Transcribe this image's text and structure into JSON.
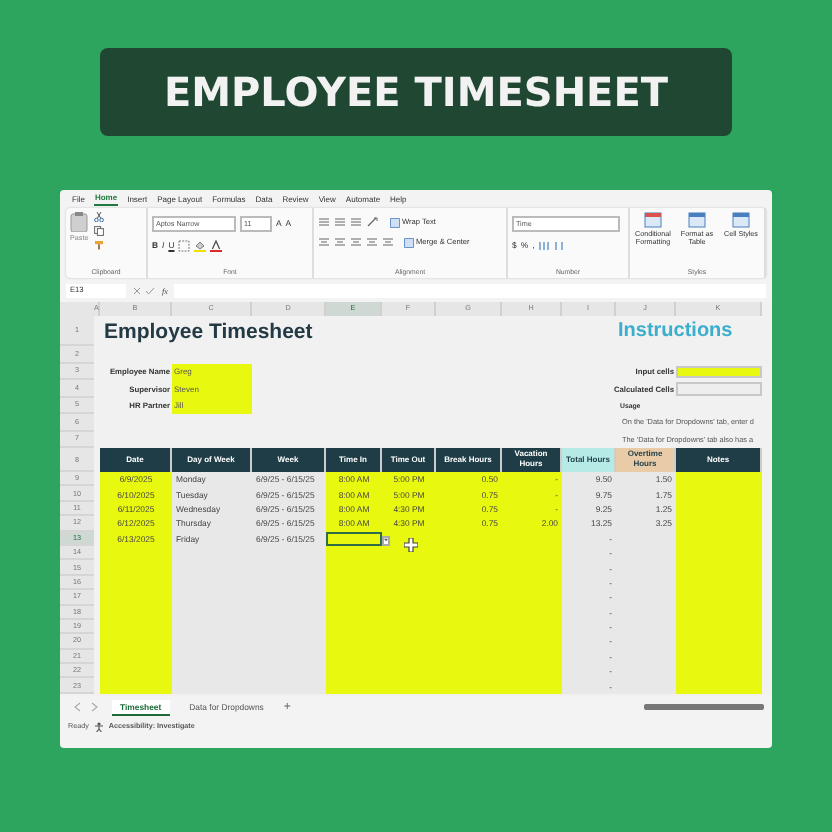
{
  "banner": {
    "title": "EMPLOYEE TIMESHEET"
  },
  "menu": [
    {
      "label": "File",
      "selected": false
    },
    {
      "label": "Home",
      "selected": true
    },
    {
      "label": "Insert",
      "selected": false
    },
    {
      "label": "Page Layout",
      "selected": false
    },
    {
      "label": "Formulas",
      "selected": false
    },
    {
      "label": "Data",
      "selected": false
    },
    {
      "label": "Review",
      "selected": false
    },
    {
      "label": "View",
      "selected": false
    },
    {
      "label": "Automate",
      "selected": false
    },
    {
      "label": "Help",
      "selected": false
    }
  ],
  "ribbon": {
    "paste": "Paste",
    "font_name": "Aptos Narrow",
    "font_size": "11",
    "size_buttons": [
      "A",
      "A"
    ],
    "style_buttons": [
      "B",
      "I",
      "U"
    ],
    "wrap_text": "Wrap Text",
    "merge": "Merge & Center",
    "number_format": "Time",
    "number_buttons": [
      "$",
      "%",
      ","
    ],
    "style_commands": [
      "Conditional Formatting",
      "Format as Table",
      "Cell Styles"
    ],
    "groups": [
      "Clipboard",
      "Font",
      "Alignment",
      "Number",
      "Styles"
    ]
  },
  "formula_bar": {
    "name_box": "E13",
    "fx": "fx"
  },
  "column_headers": [
    {
      "label": "A",
      "selected": false
    },
    {
      "label": "B",
      "selected": false
    },
    {
      "label": "C",
      "selected": false
    },
    {
      "label": "D",
      "selected": false
    },
    {
      "label": "E",
      "selected": true
    },
    {
      "label": "F",
      "selected": false
    },
    {
      "label": "G",
      "selected": false
    },
    {
      "label": "H",
      "selected": false
    },
    {
      "label": "I",
      "selected": false
    },
    {
      "label": "J",
      "selected": false
    },
    {
      "label": "K",
      "selected": false
    }
  ],
  "row_headers": [
    {
      "label": "1",
      "selected": false
    },
    {
      "label": "2",
      "selected": false
    },
    {
      "label": "3",
      "selected": false
    },
    {
      "label": "4",
      "selected": false
    },
    {
      "label": "5",
      "selected": false
    },
    {
      "label": "6",
      "selected": false
    },
    {
      "label": "7",
      "selected": false
    },
    {
      "label": "8",
      "selected": false
    },
    {
      "label": "9",
      "selected": false
    },
    {
      "label": "10",
      "selected": false
    },
    {
      "label": "11",
      "selected": false
    },
    {
      "label": "12",
      "selected": false
    },
    {
      "label": "13",
      "selected": true
    },
    {
      "label": "14",
      "selected": false
    },
    {
      "label": "15",
      "selected": false
    },
    {
      "label": "16",
      "selected": false
    },
    {
      "label": "17",
      "selected": false
    },
    {
      "label": "18",
      "selected": false
    },
    {
      "label": "19",
      "selected": false
    },
    {
      "label": "20",
      "selected": false
    },
    {
      "label": "21",
      "selected": false
    },
    {
      "label": "22",
      "selected": false
    },
    {
      "label": "23",
      "selected": false
    }
  ],
  "sheet_title": "Employee Timesheet",
  "fields": [
    {
      "label": "Employee Name",
      "value": "Greg"
    },
    {
      "label": "Supervisor",
      "value": "Steven"
    },
    {
      "label": "HR Partner",
      "value": "Jill"
    }
  ],
  "instructions": {
    "title": "Instructions",
    "legend": [
      {
        "label": "Input cells",
        "color": "#e9f80f"
      },
      {
        "label": "Calculated Cells",
        "color": "#eeeeee"
      }
    ],
    "usage_title": "Usage",
    "lines": [
      "On the 'Data for Dropdowns' tab, enter d",
      "The 'Data for Dropdowns' tab also has a"
    ]
  },
  "table": {
    "columns": [
      {
        "label": "Date",
        "kind": "input",
        "color": "#1e3d47"
      },
      {
        "label": "Day of Week",
        "kind": "calculated",
        "color": "#1e3d47"
      },
      {
        "label": "Week",
        "kind": "calculated",
        "color": "#1e3d47"
      },
      {
        "label": "Time In",
        "kind": "input",
        "color": "#1e3d47"
      },
      {
        "label": "Time Out",
        "kind": "input",
        "color": "#1e3d47"
      },
      {
        "label": "Break Hours",
        "kind": "input",
        "color": "#1e3d47"
      },
      {
        "label": "Vacation Hours",
        "kind": "input",
        "color": "#1e3d47"
      },
      {
        "label": "Total Hours",
        "kind": "calculated",
        "color": "#b6eae6"
      },
      {
        "label": "Overtime Hours",
        "kind": "calculated",
        "color": "#e9cba8"
      },
      {
        "label": "Notes",
        "kind": "input",
        "color": "#1e3d47"
      }
    ],
    "rows": [
      {
        "date": "6/9/2025",
        "day": "Monday",
        "week": "6/9/25 - 6/15/25",
        "time_in": "8:00 AM",
        "time_out": "5:00 PM",
        "break_hours": "0.50",
        "vacation_hours": "-",
        "total_hours": "9.50",
        "overtime_hours": "1.50"
      },
      {
        "date": "6/10/2025",
        "day": "Tuesday",
        "week": "6/9/25 - 6/15/25",
        "time_in": "8:00 AM",
        "time_out": "5:00 PM",
        "break_hours": "0.75",
        "vacation_hours": "-",
        "total_hours": "9.75",
        "overtime_hours": "1.75"
      },
      {
        "date": "6/11/2025",
        "day": "Wednesday",
        "week": "6/9/25 - 6/15/25",
        "time_in": "8:00 AM",
        "time_out": "4:30 PM",
        "break_hours": "0.75",
        "vacation_hours": "-",
        "total_hours": "9.25",
        "overtime_hours": "1.25"
      },
      {
        "date": "6/12/2025",
        "day": "Thursday",
        "week": "6/9/25 - 6/15/25",
        "time_in": "8:00 AM",
        "time_out": "4:30 PM",
        "break_hours": "0.75",
        "vacation_hours": "2.00",
        "total_hours": "13.25",
        "overtime_hours": "3.25"
      },
      {
        "date": "6/13/2025",
        "day": "Friday",
        "week": "6/9/25 - 6/15/25",
        "total_hours": "-"
      },
      {
        "total_hours": "-"
      },
      {
        "total_hours": "-"
      },
      {
        "total_hours": "-"
      },
      {
        "total_hours": "-"
      },
      {
        "total_hours": "-"
      },
      {
        "total_hours": "-"
      },
      {
        "total_hours": "-"
      },
      {
        "total_hours": "-"
      },
      {
        "total_hours": "-"
      },
      {
        "total_hours": "-"
      }
    ]
  },
  "sheet_tabs": [
    {
      "label": "Timesheet",
      "selected": true
    },
    {
      "label": "Data for Dropdowns",
      "selected": false
    }
  ],
  "add_sheet": "+",
  "status": {
    "ready": "Ready",
    "accessibility": "Accessibility: Investigate"
  }
}
